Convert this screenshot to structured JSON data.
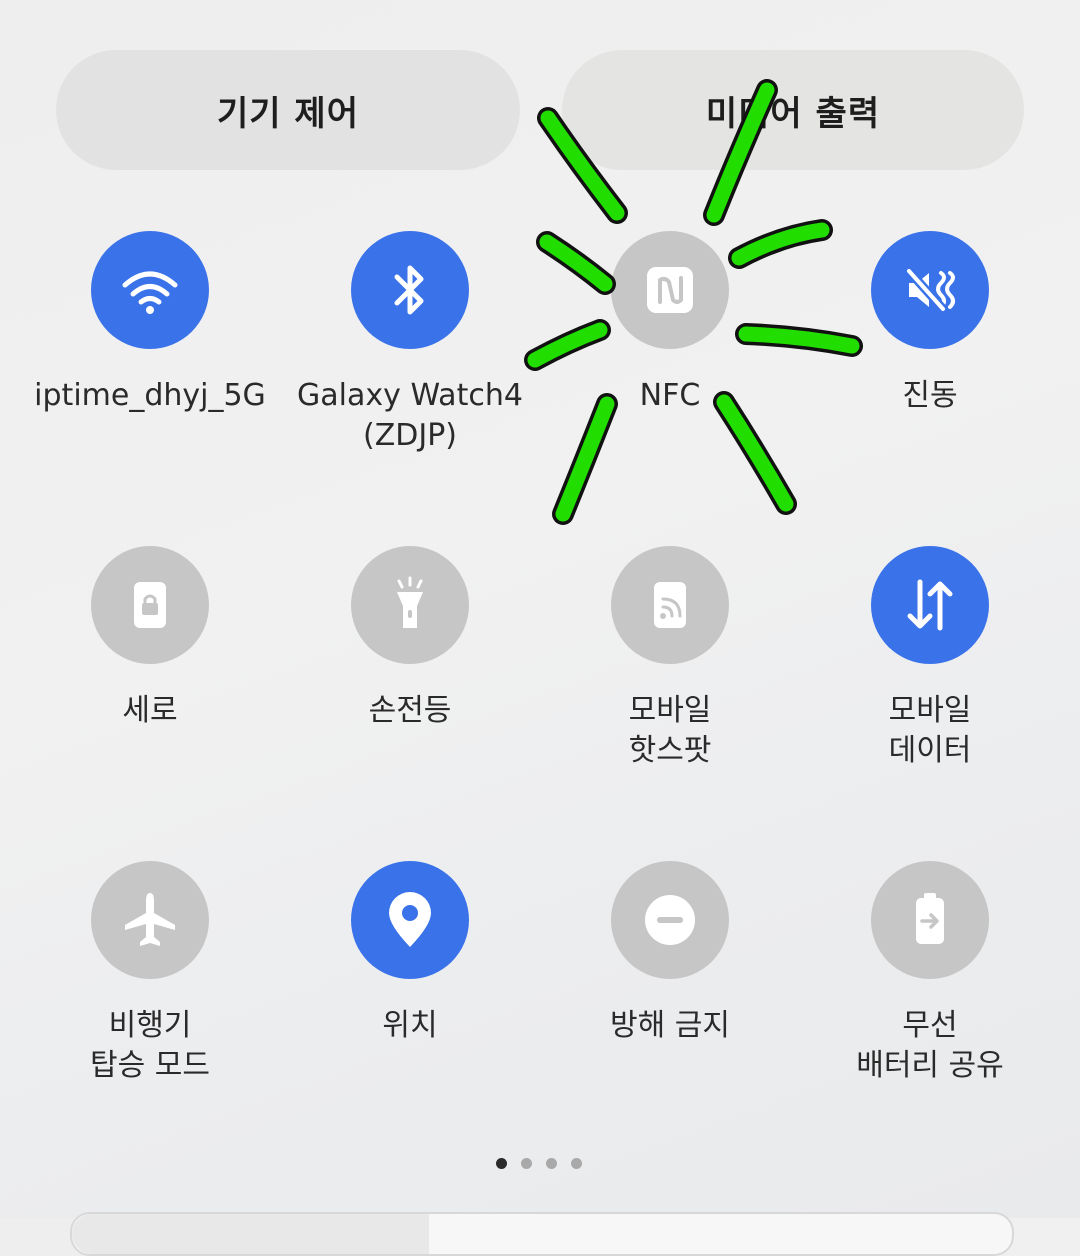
{
  "header": {
    "device_control_label": "기기 제어",
    "media_output_label": "미디어 출력"
  },
  "tiles": [
    {
      "label": "iptime_dhyj_5G",
      "icon": "wifi-icon",
      "state": "on"
    },
    {
      "label": "Galaxy Watch4\n(ZDJP)",
      "icon": "bluetooth-icon",
      "state": "on"
    },
    {
      "label": "NFC",
      "icon": "nfc-icon",
      "state": "off"
    },
    {
      "label": "진동",
      "icon": "vibrate-icon",
      "state": "on"
    },
    {
      "label": "세로",
      "icon": "portrait-lock-icon",
      "state": "off"
    },
    {
      "label": "손전등",
      "icon": "flashlight-icon",
      "state": "off"
    },
    {
      "label": "모바일\n핫스팟",
      "icon": "hotspot-icon",
      "state": "off"
    },
    {
      "label": "모바일\n데이터",
      "icon": "mobile-data-icon",
      "state": "on"
    },
    {
      "label": "비행기\n탑승 모드",
      "icon": "airplane-icon",
      "state": "off"
    },
    {
      "label": "위치",
      "icon": "location-icon",
      "state": "on"
    },
    {
      "label": "방해 금지",
      "icon": "do-not-disturb-icon",
      "state": "off"
    },
    {
      "label": "무선\n배터리 공유",
      "icon": "battery-share-icon",
      "state": "off"
    }
  ],
  "pager": {
    "pages": 4,
    "current": 1
  },
  "brightness": {
    "level": 0.38
  },
  "colors": {
    "active": "#3a72ea",
    "inactive": "#c6c6c6",
    "annotation_stroke": "#22dd00"
  }
}
